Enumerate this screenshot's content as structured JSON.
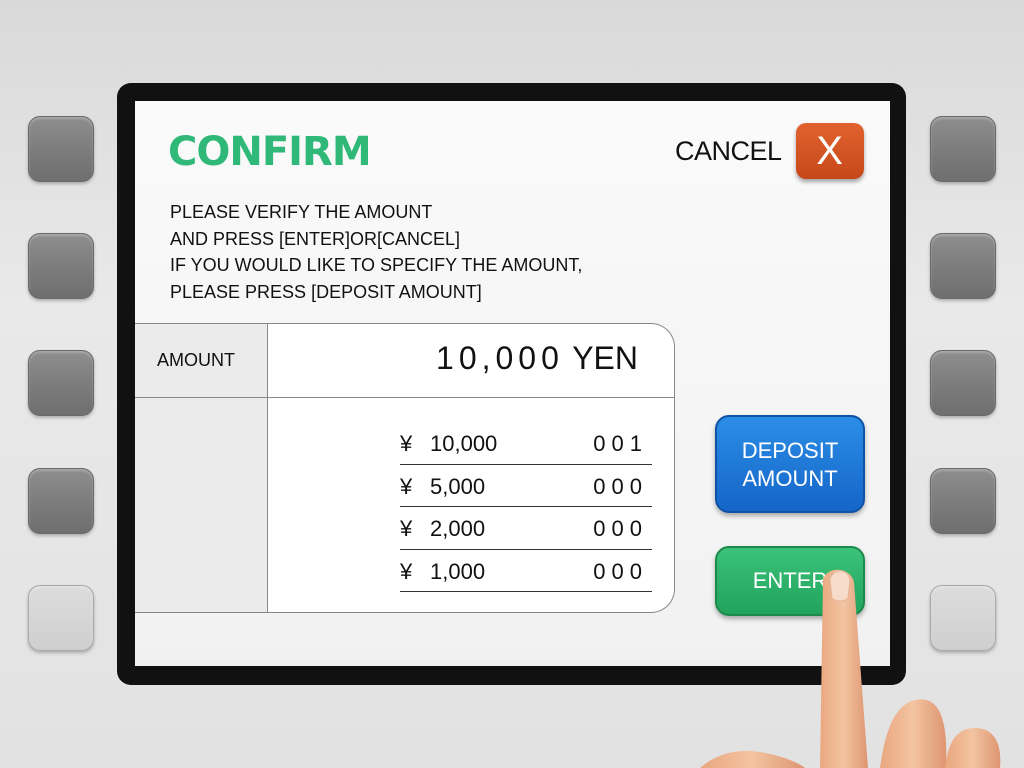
{
  "screen": {
    "title": "CONFIRM",
    "cancel": {
      "label": "CANCEL",
      "button_glyph": "X"
    },
    "instructions": [
      "PLEASE VERIFY THE AMOUNT",
      "AND PRESS [ENTER]OR[CANCEL]",
      "IF YOU WOULD LIKE TO SPECIFY THE AMOUNT,",
      "PLEASE PRESS [DEPOSIT AMOUNT]"
    ],
    "amount": {
      "label": "AMOUNT",
      "value": "10,000",
      "unit": "YEN"
    },
    "denominations": [
      {
        "symbol": "¥",
        "value": "10,000",
        "count": "001"
      },
      {
        "symbol": "¥",
        "value": "5,000",
        "count": "000"
      },
      {
        "symbol": "¥",
        "value": "2,000",
        "count": "000"
      },
      {
        "symbol": "¥",
        "value": "1,000",
        "count": "000"
      }
    ],
    "deposit_button": {
      "line1": "DEPOSIT",
      "line2": "AMOUNT"
    },
    "enter_button": {
      "label": "ENTER"
    }
  },
  "colors": {
    "title_green": "#2fb878",
    "cancel_orange": "#d4531f",
    "deposit_blue": "#1f7ad8",
    "enter_green": "#2bb268"
  },
  "icons": {
    "cancel": "close-icon"
  }
}
